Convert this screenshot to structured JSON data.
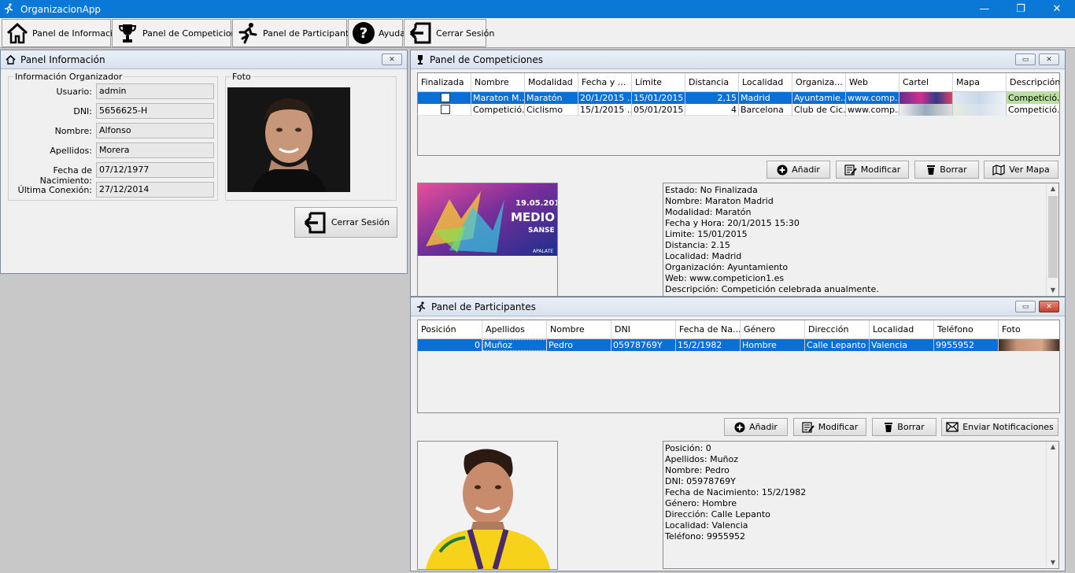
{
  "app": {
    "title": "OrganizacionApp",
    "icon": "runner-icon"
  },
  "window_controls": {
    "minimize": "—",
    "restore": "❐",
    "close": "✕"
  },
  "toolbar": {
    "items": [
      {
        "label": "Panel de Información",
        "icon": "home-icon"
      },
      {
        "label": "Panel de Competiciones",
        "icon": "trophy-icon"
      },
      {
        "label": "Panel de Participantes",
        "icon": "runner-icon"
      },
      {
        "label": "Ayuda",
        "icon": "help-icon"
      },
      {
        "label": "Cerrar Sesión",
        "icon": "logout-icon"
      }
    ]
  },
  "info_panel": {
    "title": "Panel Información",
    "group_label": "Información Organizador",
    "photo_label": "Foto",
    "fields": [
      {
        "label": "Usuario:",
        "value": "admin"
      },
      {
        "label": "DNI:",
        "value": "5656625-H"
      },
      {
        "label": "Nombre:",
        "value": "Alfonso"
      },
      {
        "label": "Apellidos:",
        "value": "Morera"
      },
      {
        "label": "Fecha de Nacimiento:",
        "value": "07/12/1977"
      },
      {
        "label": "Última Conexión:",
        "value": "27/12/2014"
      }
    ],
    "logout_label": "Cerrar Sesión"
  },
  "competitions_panel": {
    "title": "Panel de Competiciones",
    "columns": [
      "Finalizada",
      "Nombre",
      "Modalidad",
      "Fecha y ...",
      "Límite",
      "Distancia",
      "Localidad",
      "Organiza...",
      "Web",
      "Cartel",
      "Mapa",
      "Descripción"
    ],
    "rows": [
      {
        "selected": true,
        "cells": [
          "",
          "Maraton M...",
          "Maratón",
          "20/1/2015 ...",
          "15/01/2015",
          "2,15",
          "Madrid",
          "Ayuntamie...",
          "www.comp...",
          "",
          "",
          "Competició..."
        ]
      },
      {
        "selected": false,
        "cells": [
          "",
          "Competició...",
          "Ciclismo",
          "15/1/2015 ...",
          "05/01/2015",
          "4",
          "Barcelona",
          "Club de Cic...",
          "www.comp...",
          "",
          "",
          "Competició..."
        ]
      }
    ],
    "buttons": {
      "add": "Añadir",
      "modify": "Modificar",
      "delete": "Borrar",
      "map": "Ver Mapa"
    },
    "poster": {
      "date": "19.05.2013",
      "headline": "MEDIO MA",
      "sub": "SANSE",
      "footer": "APALATE"
    },
    "details": [
      "Estado: No Finalizada",
      "Nombre: Maraton Madrid",
      "Modalidad: Maratón",
      "Fecha y Hora: 20/1/2015 15:30",
      "Limite: 15/01/2015",
      "Distancia: 2.15",
      "Localidad: Madrid",
      "Organización: Ayuntamiento",
      "Web: www.competicion1.es",
      "Descripción: Competición celebrada anualmente."
    ]
  },
  "participants_panel": {
    "title": "Panel de Participantes",
    "columns": [
      "Posición",
      "Apellidos",
      "Nombre",
      "DNI",
      "Fecha de Na...",
      "Género",
      "Dirección",
      "Localidad",
      "Teléfono",
      "Foto"
    ],
    "rows": [
      {
        "selected": true,
        "cells": [
          "0",
          "Muñoz",
          "Pedro",
          "05978769Y",
          "15/2/1982",
          "Hombre",
          "Calle Lepanto",
          "Valencia",
          "9955952",
          ""
        ]
      }
    ],
    "buttons": {
      "add": "Añadir",
      "modify": "Modificar",
      "delete": "Borrar",
      "notify": "Enviar Notificaciones"
    },
    "details": [
      "Posición: 0",
      "Apellidos: Muñoz",
      "Nombre: Pedro",
      "DNI: 05978769Y",
      "Fecha de Nacimiento: 15/2/1982",
      "Género: Hombre",
      "Dirección: Calle Lepanto",
      "Localidad: Valencia",
      "Teléfono: 9955952"
    ]
  }
}
